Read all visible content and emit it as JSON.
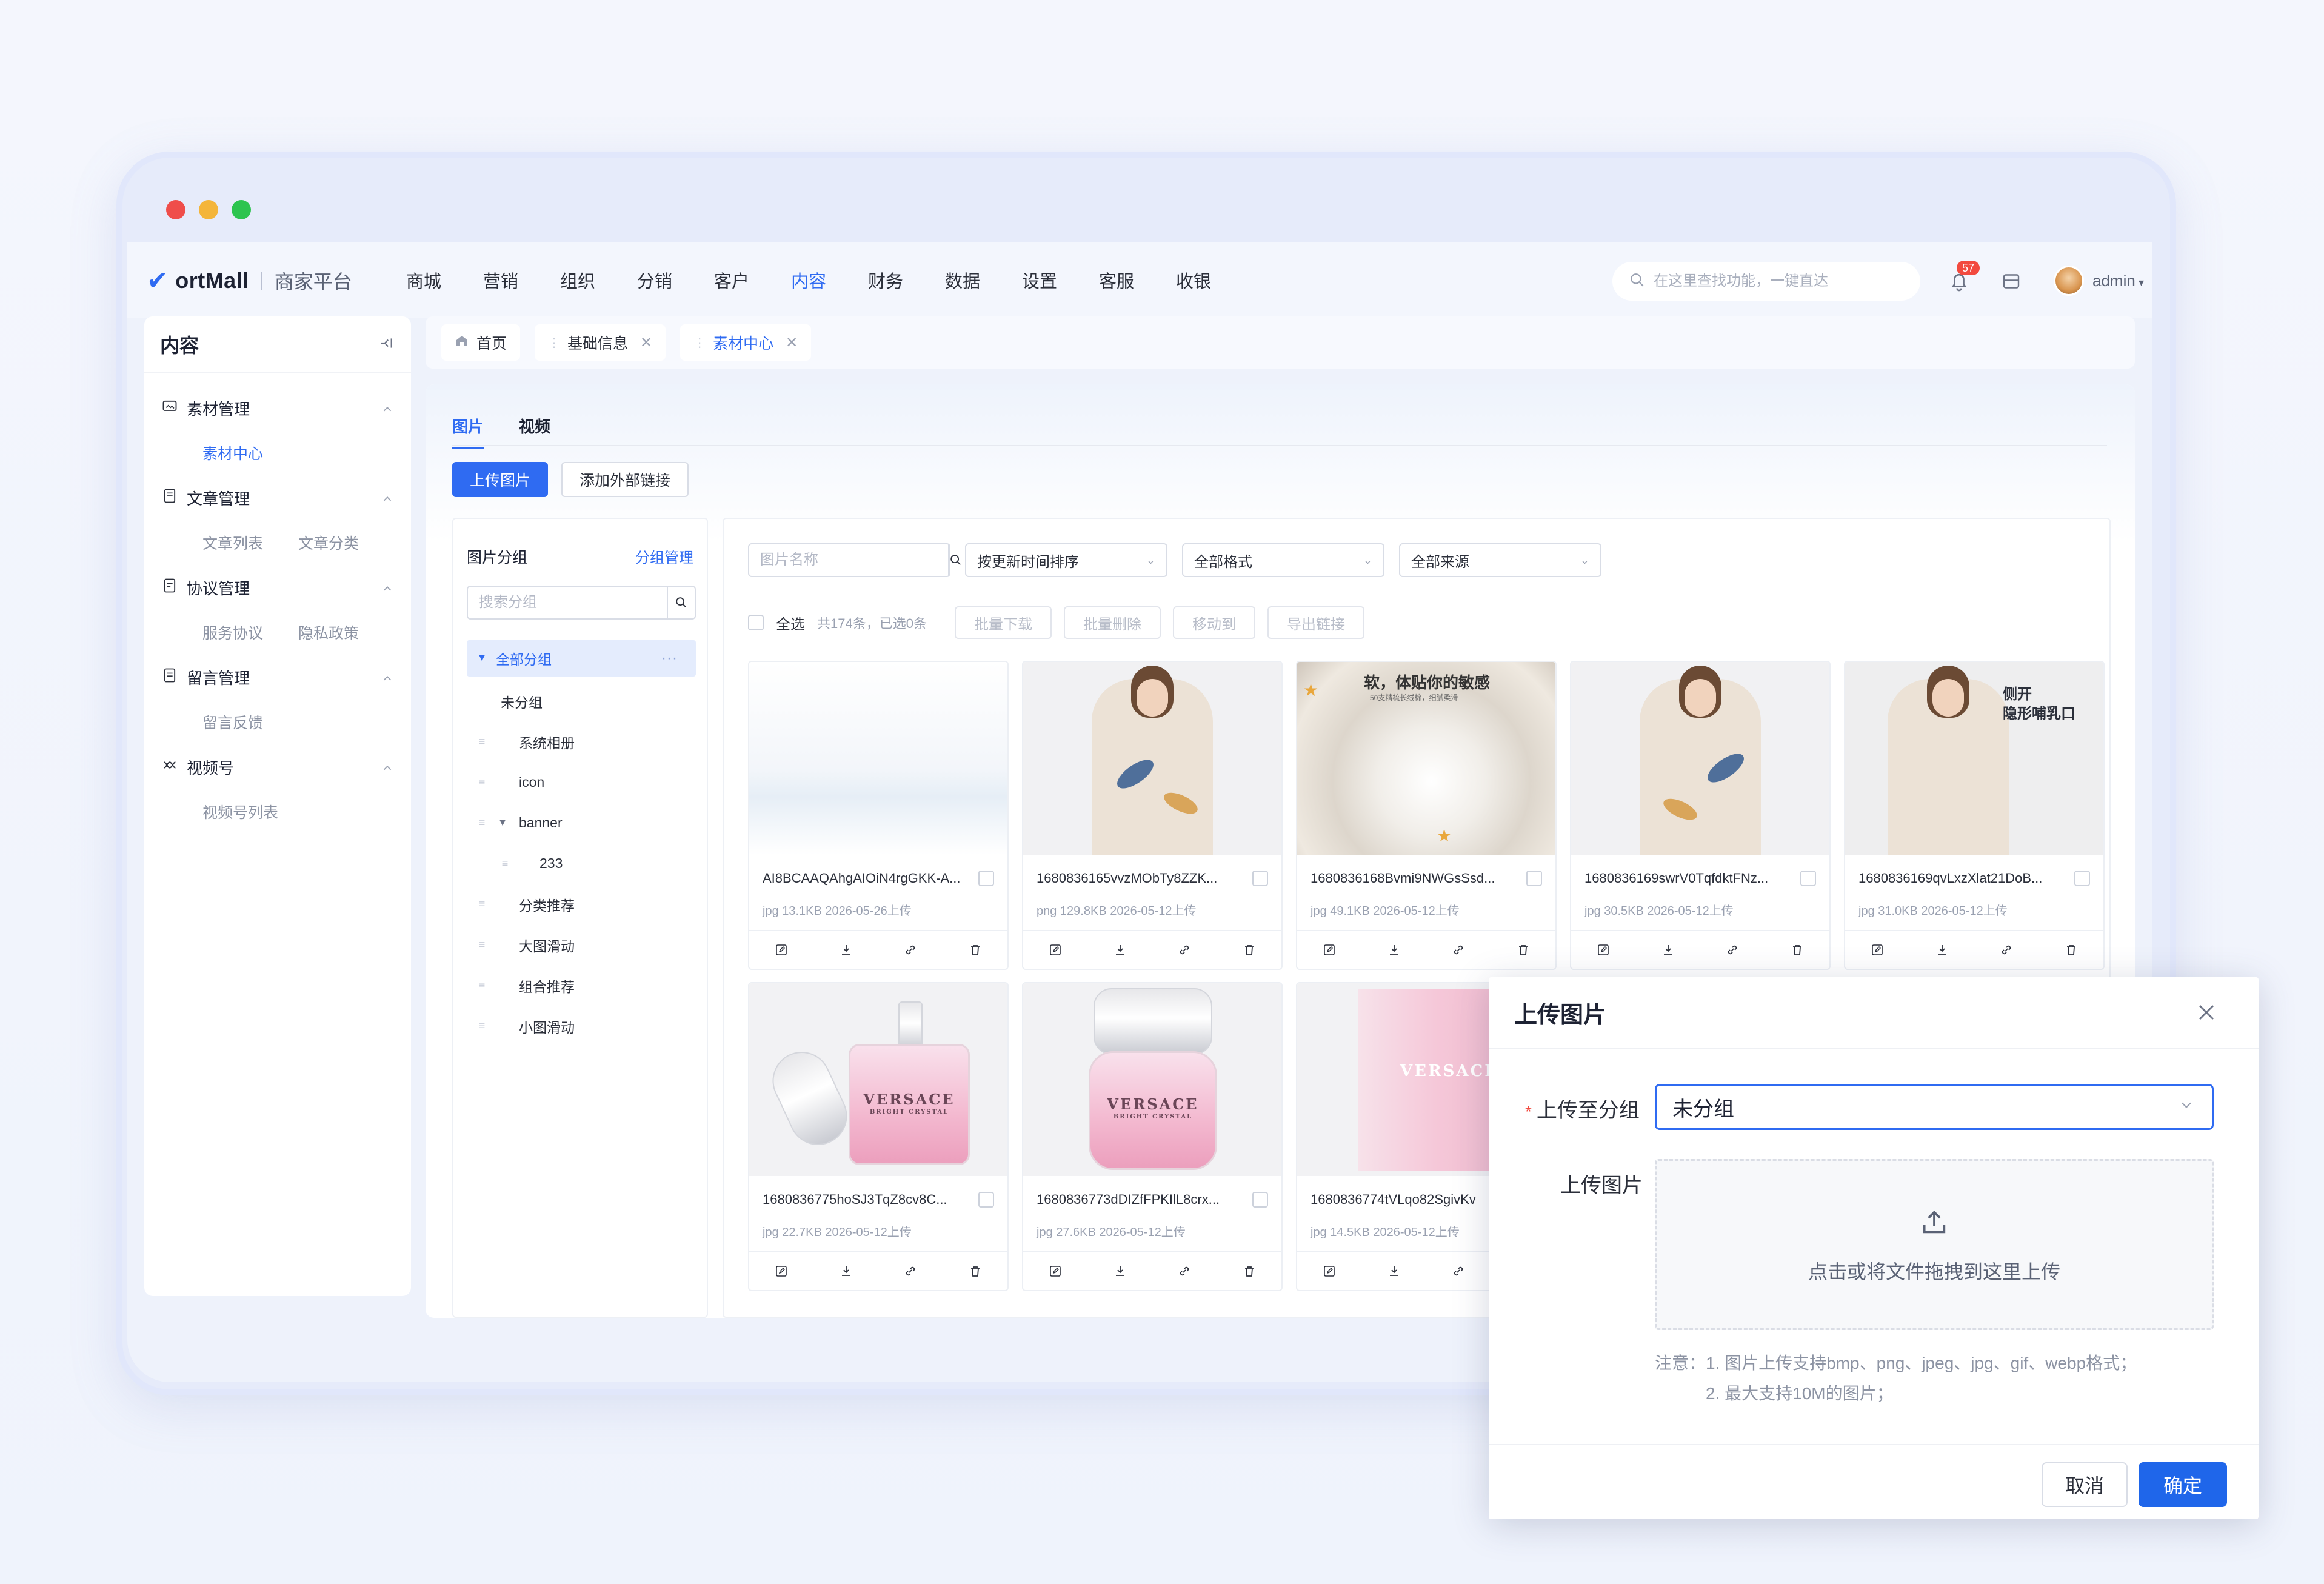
{
  "brand": {
    "logo_text": "ortMall",
    "sub": "商家平台"
  },
  "nav": {
    "items": [
      "商城",
      "营销",
      "组织",
      "分销",
      "客户",
      "内容",
      "财务",
      "数据",
      "设置",
      "客服",
      "收银"
    ],
    "active": "内容"
  },
  "header": {
    "search_placeholder": "在这里查找功能，一键直达",
    "notification_count": "57",
    "user": "admin"
  },
  "sidebar": {
    "title": "内容",
    "groups": [
      {
        "label": "素材管理",
        "icon": "image-folder-icon",
        "subs": [
          "素材中心"
        ]
      },
      {
        "label": "文章管理",
        "icon": "article-icon",
        "subs": [
          "文章列表",
          "文章分类"
        ]
      },
      {
        "label": "协议管理",
        "icon": "agreement-icon",
        "subs": [
          "服务协议",
          "隐私政策"
        ]
      },
      {
        "label": "留言管理",
        "icon": "message-icon",
        "subs": [
          "留言反馈"
        ]
      },
      {
        "label": "视频号",
        "icon": "video-channel-icon",
        "subs": [
          "视频号列表"
        ]
      }
    ]
  },
  "tabs": [
    {
      "label": "首页",
      "icon": "home-icon"
    },
    {
      "label": "基础信息"
    },
    {
      "label": "素材中心",
      "active": true
    }
  ],
  "content": {
    "type_tabs": [
      "图片",
      "视频"
    ],
    "upload_btn": "上传图片",
    "external_btn": "添加外部链接",
    "group_panel": {
      "title": "图片分组",
      "manage": "分组管理",
      "search_placeholder": "搜索分组",
      "tree": [
        {
          "label": "全部分组",
          "level": 0,
          "selected": true,
          "expanded": true
        },
        {
          "label": "未分组",
          "level": 1
        },
        {
          "label": "系统相册",
          "level": 1,
          "handle": true
        },
        {
          "label": "icon",
          "level": 1,
          "handle": true
        },
        {
          "label": "banner",
          "level": 1,
          "handle": true,
          "expanded": true
        },
        {
          "label": "233",
          "level": 2,
          "handle": true
        },
        {
          "label": "分类推荐",
          "level": 1,
          "handle": true
        },
        {
          "label": "大图滑动",
          "level": 1,
          "handle": true
        },
        {
          "label": "组合推荐",
          "level": 1,
          "handle": true
        },
        {
          "label": "小图滑动",
          "level": 1,
          "handle": true
        }
      ]
    },
    "filters": {
      "name_placeholder": "图片名称",
      "sort": "按更新时间排序",
      "format": "全部格式",
      "source": "全部来源"
    },
    "bulk": {
      "select_all": "全选",
      "count": "共174条，已选0条",
      "actions": [
        "批量下载",
        "批量删除",
        "移动到",
        "导出链接"
      ]
    },
    "images": [
      {
        "name": "AI8BCAAQAhgAIOiN4rgGKK-A...",
        "meta": "jpg 13.1KB 2026-05-26上传",
        "kind": "blank"
      },
      {
        "name": "1680836165vvzMObTy8ZZK...",
        "meta": "png 129.8KB 2026-05-12上传",
        "kind": "pajama"
      },
      {
        "name": "1680836168Bvmi9NWGsSsd...",
        "meta": "jpg 49.1KB 2026-05-12上传",
        "kind": "fabric",
        "overlay": "软，体贴你的敏感",
        "overlay_sub": "50支精梳长绒棉，细腻柔滑"
      },
      {
        "name": "1680836169swrV0TqfdktFNz...",
        "meta": "jpg 30.5KB 2026-05-12上传",
        "kind": "pajama"
      },
      {
        "name": "1680836169qvLxzXlat21DoB...",
        "meta": "jpg 31.0KB 2026-05-12上传",
        "kind": "pajama2",
        "overlay": "侧开\n隐形哺乳口"
      },
      {
        "name": "1680836775hoSJ3TqZ8cv8C...",
        "meta": "jpg 22.7KB 2026-05-12上传",
        "kind": "perfume1",
        "brand": "VERSACE",
        "brand_sub": "BRIGHT CRYSTAL"
      },
      {
        "name": "1680836773dDIZfFPKIlL8crx...",
        "meta": "jpg 27.6KB 2026-05-12上传",
        "kind": "perfume2",
        "brand": "VERSACE",
        "brand_sub": "BRIGHT CRYSTAL"
      },
      {
        "name": "1680836774tVLqo82SgivKv",
        "meta": "jpg 14.5KB 2026-05-12上传",
        "kind": "box",
        "brand": "VERSACE"
      }
    ]
  },
  "modal": {
    "title": "上传图片",
    "group_label": "上传至分组",
    "group_value": "未分组",
    "upload_label": "上传图片",
    "upload_hint": "点击或将文件拖拽到这里上传",
    "note_prefix": "注意：",
    "notes": [
      "1. 图片上传支持bmp、png、jpeg、jpg、gif、webp格式；",
      "2. 最大支持10M的图片；"
    ],
    "cancel": "取消",
    "confirm": "确定"
  },
  "colors": {
    "primary": "#2f6bf2",
    "danger": "#f24a3f"
  }
}
